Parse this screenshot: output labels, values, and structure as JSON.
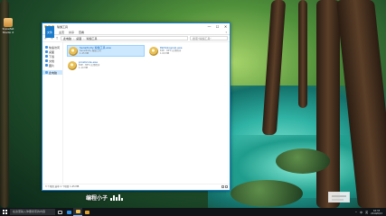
{
  "desktop": {
    "icon_label": "Snowfall Studio X"
  },
  "window": {
    "title": "瑜伽工具",
    "controls": [
      "—",
      "☐",
      "✕"
    ],
    "ribbon_tabs": [
      "文件",
      "主页",
      "共享",
      "查看"
    ],
    "ribbon_help": "?",
    "address": [
      "此电脑",
      "桌面",
      "瑜伽工具"
    ],
    "search_placeholder": "搜索\"瑜伽工具\"",
    "sidebar": [
      {
        "label": "快速访问",
        "icon": "star-icon"
      },
      {
        "label": "桌面",
        "icon": "desktop-icon"
      },
      {
        "label": "下载",
        "icon": "download-icon"
      },
      {
        "label": "文档",
        "icon": "document-icon"
      },
      {
        "label": "图片",
        "icon": "picture-icon"
      },
      {
        "label": "此电脑",
        "icon": "pc-icon"
      }
    ],
    "files": [
      {
        "name": "Sensitivity 瑜伽工具.exe",
        "meta1": "Sensitivity 瑜伽工具",
        "meta2": "1.45 MB"
      },
      {
        "name": "Pathological.exe",
        "meta1": "EXE · MFC 应用程序",
        "meta2": "1.00 MB"
      },
      {
        "name": "prosticole.exe",
        "meta1": "EXE · MFC 应用程序",
        "meta2": "1.10 MB"
      }
    ],
    "status": "3 个项目   选中 1 个项目  1.45 MB"
  },
  "watermark": "编程小子",
  "taskbar": {
    "search_placeholder": "在这里输入你要搜索的内容",
    "tray_items": [
      "^",
      "中",
      "英"
    ],
    "time": "16:33",
    "date": "2019/6/13"
  }
}
